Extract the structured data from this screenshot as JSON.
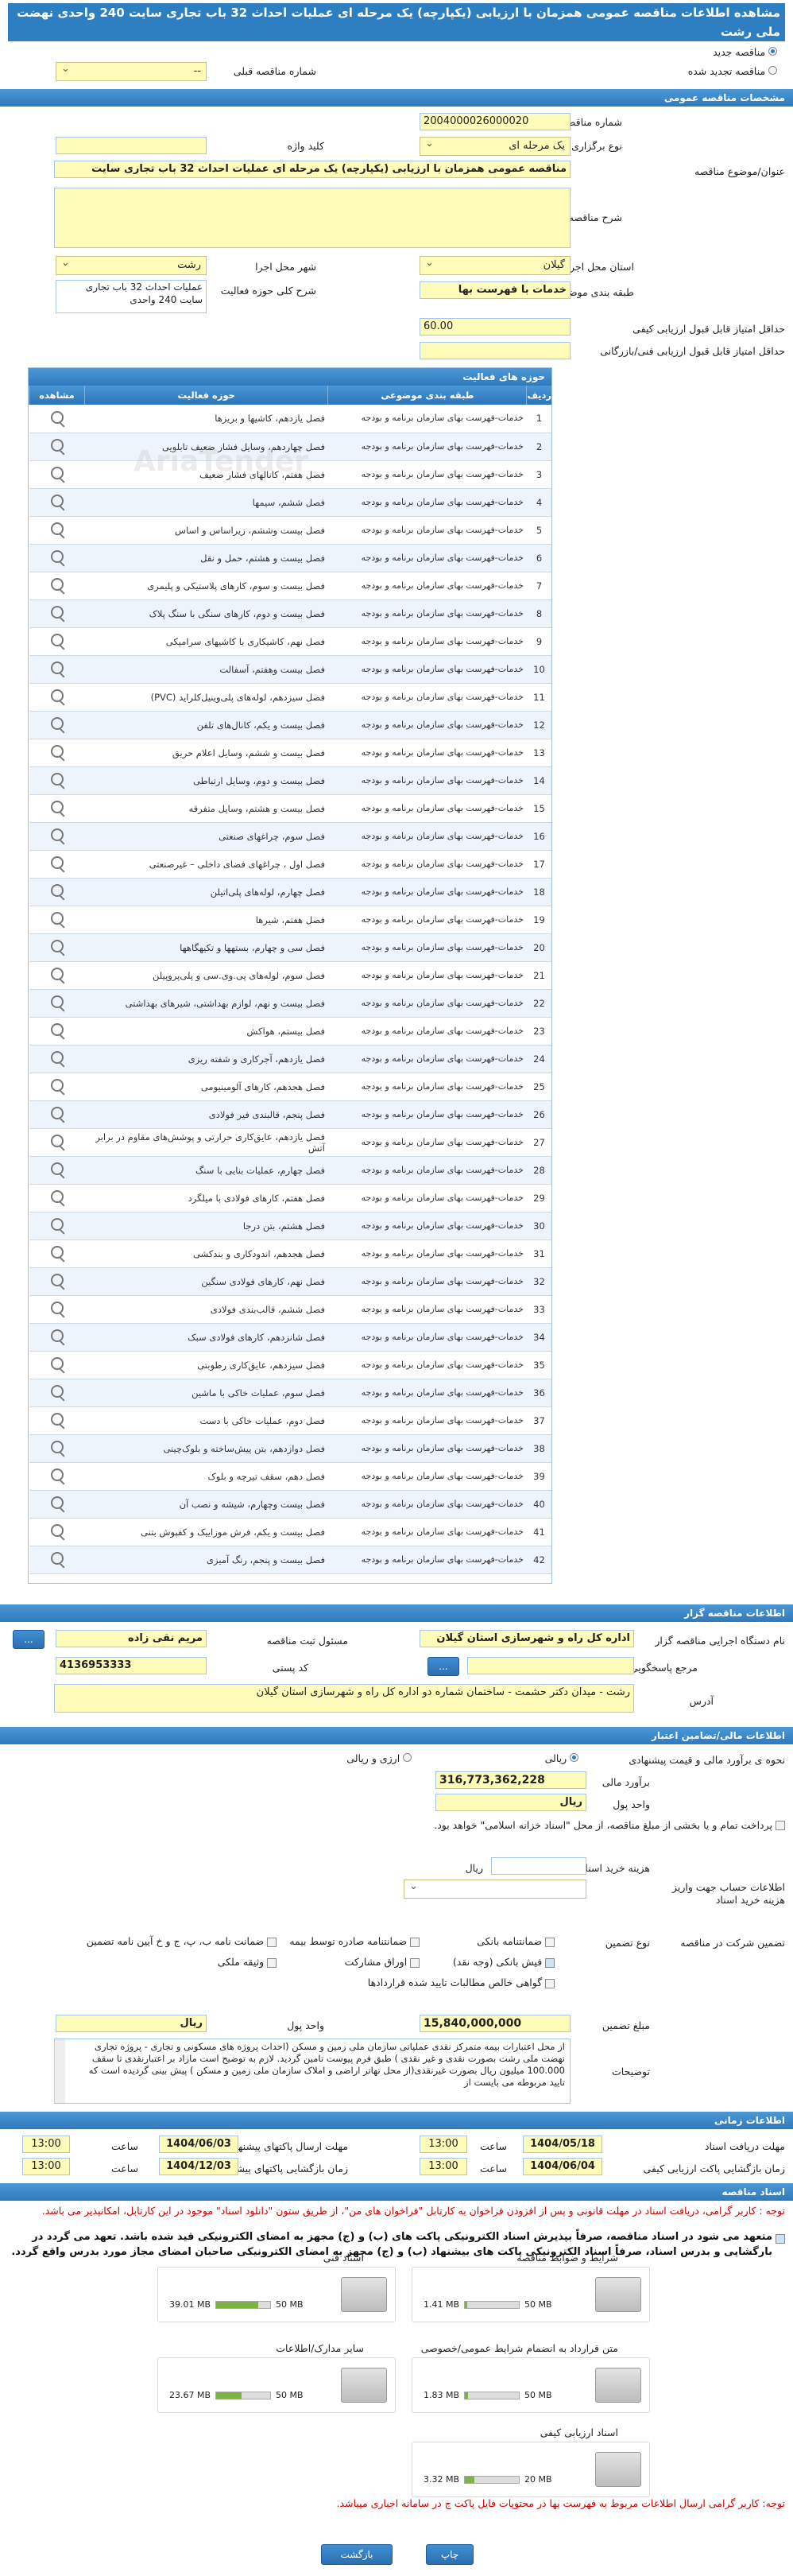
{
  "title": "مشاهده اطلاعات مناقصه عمومی همزمان با ارزیابی (یکپارچه) یک مرحله ای عملیات احداث 32 باب تجاری سایت 240 واحدی نهضت ملی رشت",
  "top": {
    "new_label": "مناقصه جدید",
    "renew_label": "مناقصه تجدید شده",
    "renew_number_label": "شماره مناقصه قبلی",
    "renew_number_value": "--"
  },
  "general": {
    "section": "مشخصات مناقصه عمومی",
    "number_label": "شماره مناقصه",
    "number_value": "2004000026000020",
    "type_label": "نوع برگزاری",
    "type_value": "یک مرحله ای",
    "keyword_label": "کلید واژه",
    "keyword_value": "",
    "subject_label": "عنوان/موضوع مناقصه",
    "subject_value": "مناقصه عمومی همزمان با ارزیابی (یکپارچه) یک مرحله ای عملیات احداث 32 باب تجاری سایت",
    "desc_label": "شرح مناقصه",
    "desc_value": "",
    "province_label": "استان محل اجرا",
    "province_value": "گیلان",
    "city_label": "شهر محل اجرا",
    "city_value": "رشت",
    "category_label": "طبقه بندی موضوعی",
    "category_value": "خدمات با فهرست بها",
    "scope_label": "شرح کلی حوزه فعالیت",
    "scope_value": "عملیات احداث 32 باب تجاری سایت 240 واحدی",
    "min_quality_label": "حداقل امتیاز قابل قبول ارزیابی کیفی",
    "min_quality_value": "60.00",
    "min_tech_label": "حداقل امتیاز قابل قبول ارزیابی فنی/بازرگانی",
    "min_tech_value": ""
  },
  "activities": {
    "section": "حوزه های فعالیت",
    "headers": {
      "row": "ردیف",
      "category": "طبقه بندی موضوعی",
      "activity": "حوزه فعالیت",
      "view": "مشاهده"
    },
    "category_text": "خدمات-فهرست بهای سازمان برنامه و بودجه",
    "rows": [
      "فصل یازدهم، کاشیها و بریزها",
      "فصل چهاردهم، وسایل فشار ضعیف تابلویی",
      "فصل هفتم، کانالهای فشار ضعیف",
      "فصل ششم، سیمها",
      "فصل بیست وششم، زیراساس و اساس",
      "فصل بیست و هشتم، حمل و نقل",
      "فصل بیست و سوم، کارهای پلاستیکی و پلیمری",
      "فصل بیست و دوم، کارهای سنگی با سنگ پلاک",
      "فصل نهم، کاشیکاری با کاشیهای سرامیکی",
      "فصل بیست وهفتم، آسفالت",
      "فصل سیزدهم، لوله‌های پلی‌وینیل‌کلراید (PVC)",
      "فصل بیست و یکم، کانال‌های تلفن",
      "فصل بیست و ششم، وسایل اعلام حریق",
      "فصل بیست و دوم، وسایل ارتباطی",
      "فصل بیست و هشتم، وسایل متفرقه",
      "فصل سوم، چراغهای صنعتی",
      "فصل اول ، چراغهای فضای داخلی – غیرصنعتی",
      "فصل چهارم، لوله‌های پلی‌اتیلن",
      "فصل هفتم، شیرها",
      "فصل سی و چهارم، بستهها و تکیهگاهها",
      "فصل سوم، لوله‌های پی.وی.سی و پلی‌پروپیلن",
      "فصل بیست و نهم، لوازم بهداشتی، شیرهای بهداشتی",
      "فصل بیستم، هواکش",
      "فصل یازدهم، آجرکاری و شفته ریزی",
      "فصل هجدهم، کارهای آلومینیومی",
      "فصل پنجم، قالبندی فیر فولادی",
      "فصل یازدهم، عایق‌کاری حرارتی و پوشش‌های مقاوم در برابر آتش",
      "فصل چهارم، عملیات بنایی با سنگ",
      "فصل هفتم، کارهای فولادی با میلگرد",
      "فصل هشتم، بتن درجا",
      "فصل هجدهم، اندودکاری و بندکشی",
      "فصل نهم، کارهای فولادی سنگین",
      "فصل ششم، قالب‌بندی فولادی",
      "فصل شانزدهم، کارهای فولادی سبک",
      "فصل سیزدهم، عایق‌کاری رطوبتی",
      "فصل سوم، عملیات خاکی با ماشین",
      "فصل دوم، عملیات خاکی با دست",
      "فصل دوازدهم، بتن پیش‌ساخته و بلوک‌چینی",
      "فصل دهم، سقف تیرچه و بلوک",
      "فصل بیست وچهارم، شیشه و نصب آن",
      "فصل بیست و یکم، فرش موزاییک و کفپوش بتنی",
      "فصل بیست و پنجم، رنگ آمیزی"
    ]
  },
  "organizer": {
    "section": "اطلاعات مناقصه گزار",
    "device_label": "نام دستگاه اجرایی مناقصه گزار",
    "device_value": "اداره کل راه و شهرسازی استان گیلان",
    "responsible_label": "مسئول ثبت مناقصه",
    "responsible_value": "مریم نقی زاده",
    "reference_label": "مرجع پاسخگویی",
    "reference_value": "",
    "postal_label": "کد پستی",
    "postal_value": "4136953333",
    "address_label": "آدرس",
    "address_value": "رشت - میدان دکتر حشمت - ساختمان شماره دو اداره کل راه و شهرسازی استان گیلان",
    "more": "...",
    "search_btn": "..."
  },
  "finance": {
    "section": "اطلاعات مالی/تضامین اعتبار",
    "estimate_label": "نحوه ی برآورد مالی و قیمت پیشنهادی",
    "rial_label": "ریالی",
    "rial_fx_label": "ارزی و ریالی",
    "financial_label": "برآورد مالی",
    "financial_value": "316,773,362,228",
    "currency_label": "واحد پول",
    "currency_value": "ریال",
    "payment_note": "پرداخت تمام و یا بخشی از مبلغ مناقصه، از محل \"اسناد خزانه اسلامی\" خواهد بود.",
    "doc_cost_label": "هزینه خرید اسناد",
    "doc_cost_value": "",
    "doc_cost_unit": "ریال",
    "account_label": "اطلاعات حساب جهت واریز هزینه خرید اسناد",
    "account_value": "",
    "participate_label": "تضمین شرکت در مناقصه",
    "guarantee_type_label": "نوع تضمین",
    "g_bank": "ضمانتنامه بانکی",
    "g_insurance": "ضمانتنامه صادره توسط بیمه",
    "g_cheque": "ضمانت نامه ب، پ، ج و خ آیین نامه تضمین",
    "g_receipt": "فیش بانکی (وجه نقد)",
    "g_bonds": "اوراق مشارکت",
    "g_property": "وثیقه ملکی",
    "g_claims": "گواهی خالص مطالبات تایید شده قراردادها",
    "amount_label": "مبلغ تضمین",
    "amount_value": "15,840,000,000",
    "amount_currency_label": "واحد پول",
    "amount_currency_value": "ریال",
    "notes_label": "توضیحات",
    "notes_value": "از محل اعتبارات بیمه متمرکز نقدی عملیاتی سازمان ملی زمین و مسکن (احداث پروژه های مسکونی و تجاری - پروژه تجاری نهضت ملی رشت بصورت نقدی و غیر نقدی ) طبق فرم پیوست تامین گردید. لازم به توضیح است مازاد بر اعتبارنقدی تا سقف 100.000 میلیون ریال بصورت غیرنقدی(از محل تهاتر اراضی و املاک سازمان ملی زمین و مسکن ) پیش بینی گردیده است که تایید مربوطه می بایست از"
  },
  "timing": {
    "section": "اطلاعات زمانی",
    "doc_receive_label": "مهلت دریافت اسناد",
    "doc_receive_date": "1404/05/18",
    "doc_receive_time": "13:00",
    "submit_label": "مهلت ارسال پاکتهای پیشنهاد",
    "submit_date": "1404/06/03",
    "submit_time": "13:00",
    "quality_label": "زمان بازگشایی پاکت ارزیابی کیفی",
    "quality_date": "1404/06/04",
    "quality_time": "13:00",
    "opening_label": "زمان بازگشایی پاکتهای پیشنهاد",
    "opening_date": "1404/12/03",
    "opening_time": "13:00",
    "time_label": "ساعت"
  },
  "docs": {
    "section": "اسناد مناقصه",
    "warning": "توجه : کاربر گرامی، دریافت اسناد در مهلت قانونی و پس از افزودن فراخوان به کارتابل \"فراخوان های من\"، از طریق ستون \"دانلود اسناد\" موجود در این کارتابل، امکانپذیر می باشد.",
    "commit": "متعهد می شود در اسناد مناقصه، صرفاً بپذیرش اسناد الکترونیکی پاکت های (ب) و (ج) مجهز به امضای الکترونیکی قید شده باشد. تعهد می گردد در بارگشایی و بدرس اسناد، صرفاً اسناد الکترونیکی پاکت های بیشنهاد (ب) و (ج) مجهز به امضای الکترونیکی صاحبان امضای مجاز مورد بدرس واقع گردد.",
    "files": [
      {
        "name": "شرایط و ضوابط مناقصه",
        "size": "1.41 MB",
        "max": "50 MB",
        "fill": 0.05
      },
      {
        "name": "اسناد فنی",
        "size": "39.01 MB",
        "max": "50 MB",
        "fill": 0.78
      },
      {
        "name": "متن قرارداد به انضمام شرایط عمومی/خصوصی",
        "size": "1.83 MB",
        "max": "50 MB",
        "fill": 0.06
      },
      {
        "name": "سایر مدارک/اطلاعات",
        "size": "23.67 MB",
        "max": "50 MB",
        "fill": 0.47
      },
      {
        "name": "اسناد ارزیابی کیفی",
        "size": "3.32 MB",
        "max": "20 MB",
        "fill": 0.17
      }
    ],
    "note": "توجه: کاربر گرامی ارسال اطلاعات مربوط به فهرست بها در محتویات فایل پاکت ج در سامانه اجباری میباشد."
  },
  "footer": {
    "print": "چاپ",
    "back": "بازگشت"
  },
  "watermark": "AriaTender"
}
